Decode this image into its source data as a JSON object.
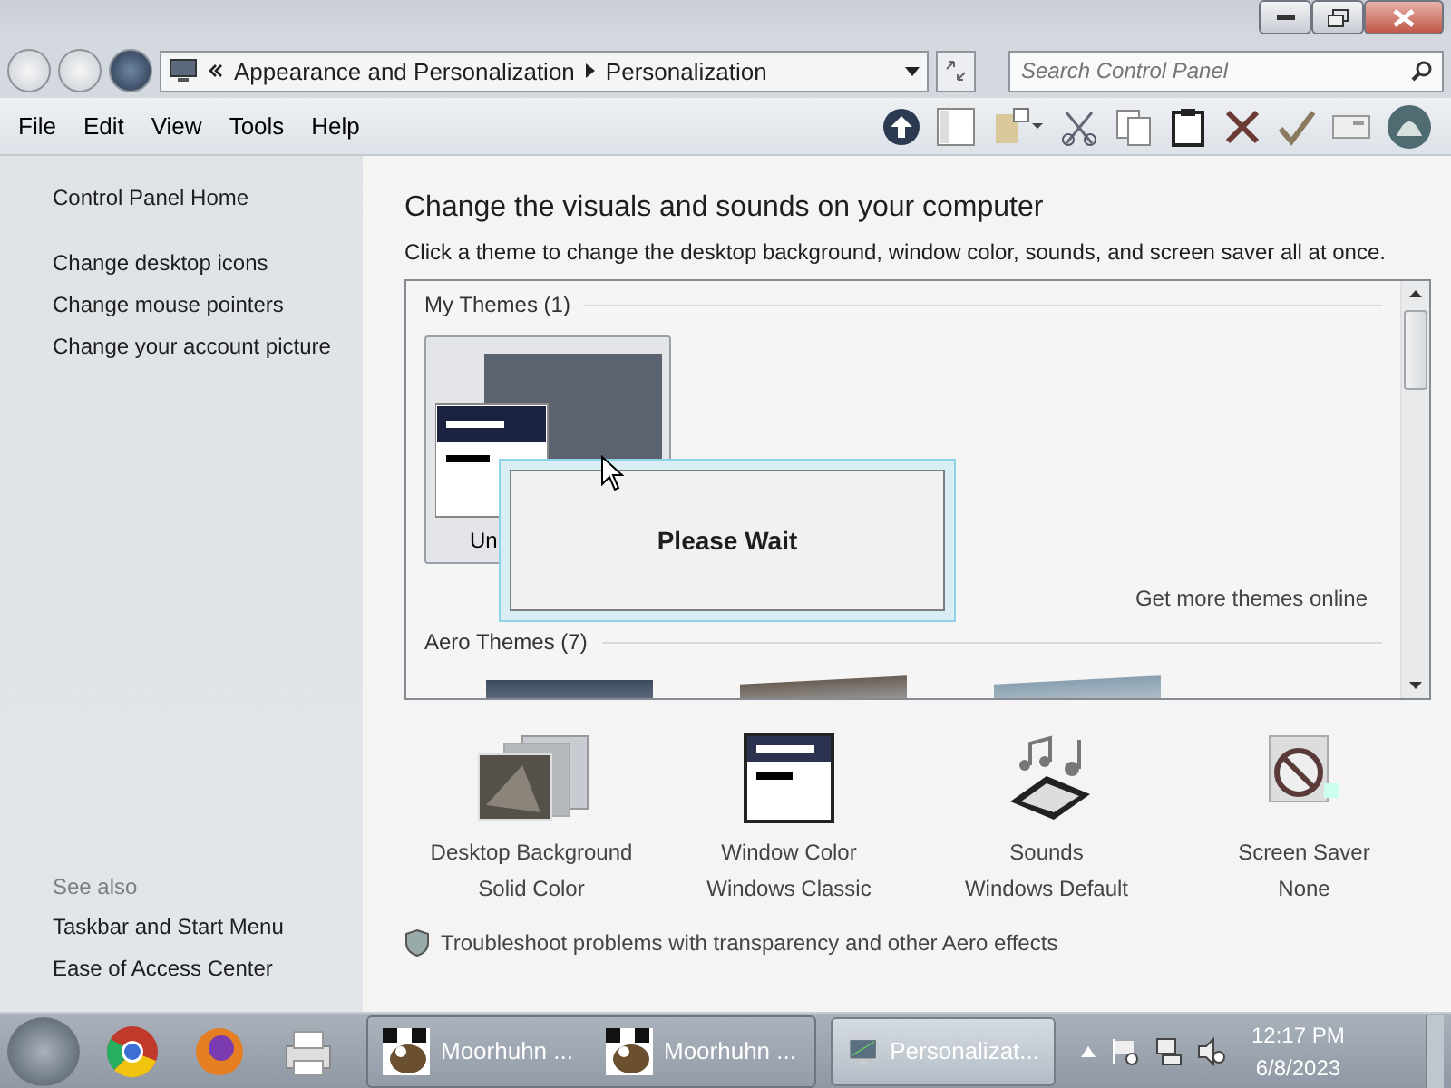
{
  "address_bar": {
    "crumbs": [
      "Appearance and Personalization",
      "Personalization"
    ],
    "search": {
      "placeholder": "Search Control Panel"
    }
  },
  "menu_bar": [
    "File",
    "Edit",
    "View",
    "Tools",
    "Help"
  ],
  "sidebar": {
    "home": "Control Panel Home",
    "tasks": [
      "Change desktop icons",
      "Change mouse pointers",
      "Change your account picture"
    ],
    "see_also": {
      "heading": "See also",
      "links": [
        "Taskbar and Start Menu",
        "Ease of Access Center"
      ]
    }
  },
  "content": {
    "title": "Change the visuals and sounds on your computer",
    "subtitle": "Click a theme to change the desktop background, window color, sounds, and screen saver all at once.",
    "themes": {
      "my_heading": "My Themes (1)",
      "my_themes": [
        {
          "label": "Un",
          "selected": true
        }
      ],
      "get_more": "Get more themes online",
      "aero_heading": "Aero Themes (7)"
    },
    "settings": [
      {
        "kind": "background",
        "label": "Desktop Background",
        "value": "Solid Color"
      },
      {
        "kind": "color",
        "label": "Window Color",
        "value": "Windows Classic"
      },
      {
        "kind": "sounds",
        "label": "Sounds",
        "value": "Windows Default"
      },
      {
        "kind": "saver",
        "label": "Screen Saver",
        "value": "None"
      }
    ],
    "troubleshoot": "Troubleshoot problems with transparency and other Aero effects"
  },
  "dialog": {
    "message": "Please Wait"
  },
  "taskbar": {
    "tasks": [
      {
        "kind": "game",
        "label": "Moorhuhn ...",
        "selected": false
      },
      {
        "kind": "game",
        "label": "Moorhuhn ...",
        "selected": false
      },
      {
        "kind": "panel",
        "label": "Personalizat...",
        "selected": true
      }
    ],
    "time": "12:17 PM",
    "date": "6/8/2023"
  }
}
